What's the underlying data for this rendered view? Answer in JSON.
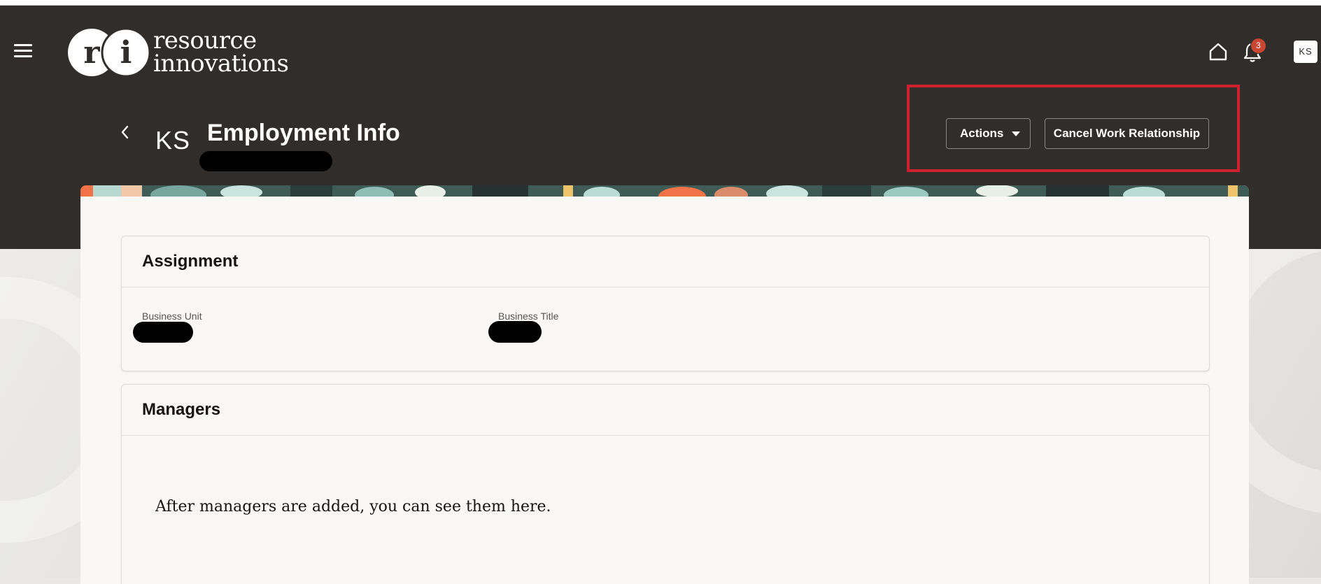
{
  "brand": {
    "name_line1": "resource",
    "name_line2": "innovations",
    "mark_letters": "ri"
  },
  "topnav": {
    "notification_count": "3",
    "user_initials": "KS"
  },
  "page_header": {
    "person_initials": "KS",
    "title": "Employment Info",
    "actions_label": "Actions",
    "cancel_label": "Cancel Work Relationship"
  },
  "assignment": {
    "title": "Assignment",
    "business_unit_label": "Business Unit",
    "business_title_label": "Business Title"
  },
  "managers": {
    "title": "Managers",
    "empty_message": "After managers are added, you can see them here."
  },
  "colors": {
    "header_bg": "#312d2a",
    "highlight_border": "#d0202f",
    "badge": "#c74634"
  }
}
